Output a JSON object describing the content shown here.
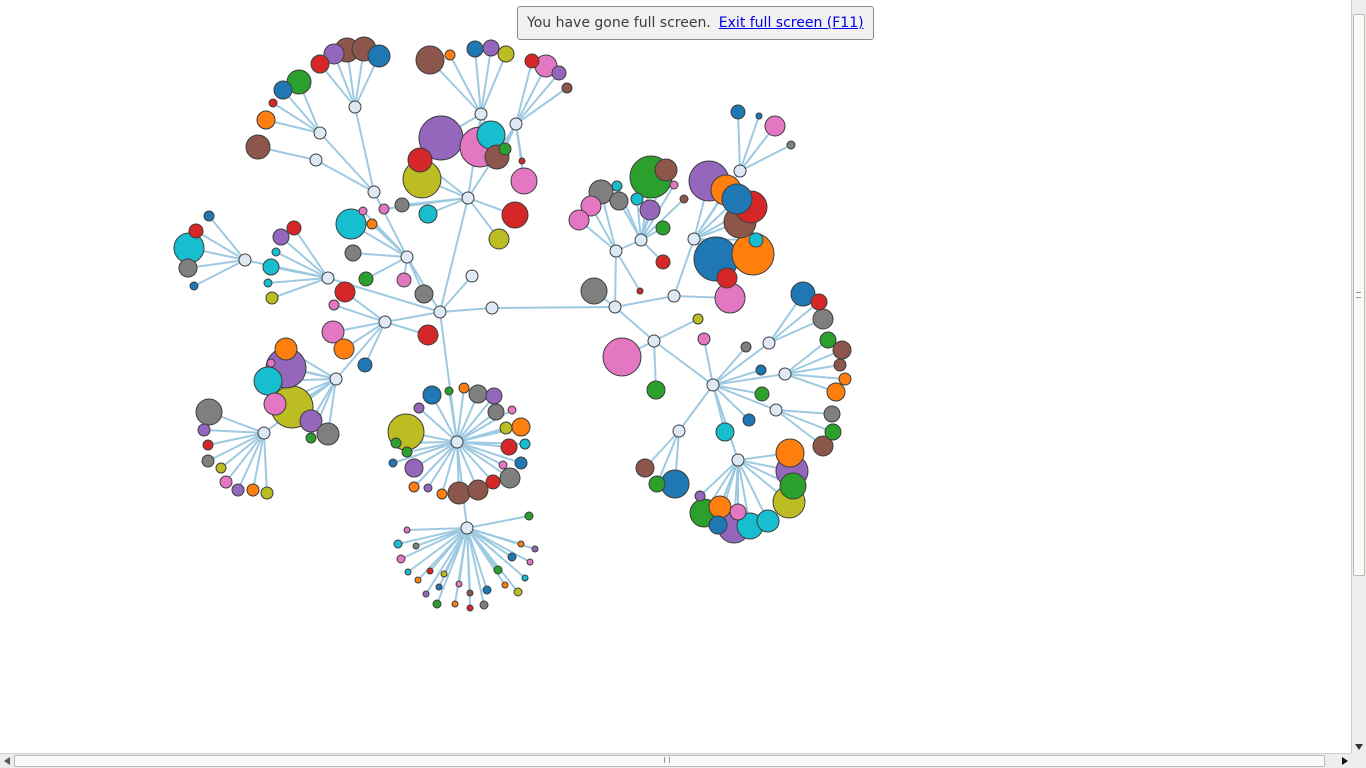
{
  "notice": {
    "message": "You have gone full screen.",
    "exit_link": "Exit full screen (F11)"
  },
  "icons": {
    "scroll_down": "arrow-down-icon",
    "scroll_left": "arrow-left-icon",
    "scroll_right": "arrow-right-icon"
  },
  "colors": {
    "link": "#9ecae1",
    "hub": "#dfe9f5",
    "stroke": "#3d3d3d",
    "palette": [
      "#1f77b4",
      "#ff7f0e",
      "#2ca02c",
      "#d62728",
      "#9467bd",
      "#8c564b",
      "#e377c2",
      "#7f7f7f",
      "#bcbd22",
      "#17becf"
    ]
  },
  "graph": {
    "type": "force-directed tree",
    "root": "root",
    "clusters": [
      {
        "id": "c-topleft",
        "parent": "h-upper",
        "leaves": [
          {
            "c": 5,
            "r": 12
          },
          {
            "c": 5,
            "r": 12
          },
          {
            "c": 0,
            "r": 11
          },
          {
            "c": 4,
            "r": 10
          },
          {
            "c": 3,
            "r": 9
          },
          {
            "c": 2,
            "r": 12
          },
          {
            "c": 0,
            "r": 9
          },
          {
            "c": 3,
            "r": 4
          },
          {
            "c": 1,
            "r": 9
          },
          {
            "c": 5,
            "r": 12
          }
        ]
      },
      {
        "id": "c-topmid",
        "parent": "h-center",
        "leaves": [
          {
            "c": 5,
            "r": 14
          },
          {
            "c": 1,
            "r": 5
          },
          {
            "c": 0,
            "r": 8
          },
          {
            "c": 4,
            "r": 8
          },
          {
            "c": 8,
            "r": 8
          },
          {
            "c": 3,
            "r": 7
          },
          {
            "c": 6,
            "r": 11
          },
          {
            "c": 4,
            "r": 7
          },
          {
            "c": 5,
            "r": 5
          },
          {
            "c": 4,
            "r": 22
          },
          {
            "c": 6,
            "r": 20
          },
          {
            "c": 8,
            "r": 19
          },
          {
            "c": 9,
            "r": 9
          },
          {
            "c": 3,
            "r": 13
          },
          {
            "c": 2,
            "r": 6
          },
          {
            "c": 6,
            "r": 13
          },
          {
            "c": 3,
            "r": 3
          },
          {
            "c": 9,
            "r": 14
          },
          {
            "c": 5,
            "r": 12
          },
          {
            "c": 7,
            "r": 7
          },
          {
            "c": 6,
            "r": 5
          },
          {
            "c": 8,
            "r": 10
          },
          {
            "c": 3,
            "r": 12
          }
        ]
      },
      {
        "id": "c-farleft",
        "parent": "h-left",
        "leaves": [
          {
            "c": 0,
            "r": 5
          },
          {
            "c": 3,
            "r": 7
          },
          {
            "c": 9,
            "r": 15
          },
          {
            "c": 7,
            "r": 9
          },
          {
            "c": 0,
            "r": 4
          }
        ]
      },
      {
        "id": "c-left",
        "parent": "h-midleft",
        "leaves": [
          {
            "c": 3,
            "r": 7
          },
          {
            "c": 4,
            "r": 8
          },
          {
            "c": 9,
            "r": 4
          },
          {
            "c": 9,
            "r": 8
          },
          {
            "c": 9,
            "r": 4
          },
          {
            "c": 8,
            "r": 6
          }
        ]
      },
      {
        "id": "c-inner",
        "parent": "root",
        "leaves": [
          {
            "c": 6,
            "r": 4
          },
          {
            "c": 1,
            "r": 5
          },
          {
            "c": 9,
            "r": 15
          },
          {
            "c": 7,
            "r": 8
          },
          {
            "c": 2,
            "r": 7
          },
          {
            "c": 6,
            "r": 7
          },
          {
            "c": 3,
            "r": 10
          },
          {
            "c": 7,
            "r": 9
          },
          {
            "c": 6,
            "r": 5
          },
          {
            "c": 6,
            "r": 11
          },
          {
            "c": 1,
            "r": 10
          },
          {
            "c": 0,
            "r": 7
          },
          {
            "c": 3,
            "r": 10
          }
        ]
      },
      {
        "id": "c-lowleft",
        "parent": "h-lowleft",
        "leaves": [
          {
            "c": 1,
            "r": 11
          },
          {
            "c": 4,
            "r": 20
          },
          {
            "c": 9,
            "r": 14
          },
          {
            "c": 8,
            "r": 21
          },
          {
            "c": 6,
            "r": 11
          },
          {
            "c": 4,
            "r": 11
          },
          {
            "c": 7,
            "r": 11
          },
          {
            "c": 2,
            "r": 5
          },
          {
            "c": 6,
            "r": 4
          }
        ]
      },
      {
        "id": "c-farlowleft",
        "parent": "h-farlowleft",
        "leaves": [
          {
            "c": 7,
            "r": 13
          },
          {
            "c": 4,
            "r": 6
          },
          {
            "c": 3,
            "r": 5
          },
          {
            "c": 7,
            "r": 6
          },
          {
            "c": 8,
            "r": 5
          },
          {
            "c": 6,
            "r": 6
          },
          {
            "c": 4,
            "r": 6
          },
          {
            "c": 1,
            "r": 6
          },
          {
            "c": 8,
            "r": 6
          }
        ]
      },
      {
        "id": "c-ring",
        "parent": "h-ring",
        "leaves": [
          {
            "c": 0,
            "r": 9
          },
          {
            "c": 2,
            "r": 4
          },
          {
            "c": 1,
            "r": 5
          },
          {
            "c": 7,
            "r": 9
          },
          {
            "c": 4,
            "r": 8
          },
          {
            "c": 7,
            "r": 8
          },
          {
            "c": 6,
            "r": 4
          },
          {
            "c": 1,
            "r": 9
          },
          {
            "c": 9,
            "r": 5
          },
          {
            "c": 3,
            "r": 8
          },
          {
            "c": 0,
            "r": 6
          },
          {
            "c": 7,
            "r": 10
          },
          {
            "c": 3,
            "r": 7
          },
          {
            "c": 5,
            "r": 10
          },
          {
            "c": 5,
            "r": 11
          },
          {
            "c": 1,
            "r": 5
          },
          {
            "c": 4,
            "r": 4
          },
          {
            "c": 1,
            "r": 5
          },
          {
            "c": 4,
            "r": 9
          },
          {
            "c": 0,
            "r": 4
          },
          {
            "c": 8,
            "r": 18
          },
          {
            "c": 2,
            "r": 5
          },
          {
            "c": 4,
            "r": 5
          },
          {
            "c": 2,
            "r": 5
          },
          {
            "c": 8,
            "r": 6
          },
          {
            "c": 6,
            "r": 4
          }
        ]
      },
      {
        "id": "c-fan",
        "parent": "h-fan",
        "leaves": [
          {
            "c": 6,
            "r": 3
          },
          {
            "c": 9,
            "r": 4
          },
          {
            "c": 7,
            "r": 3
          },
          {
            "c": 6,
            "r": 4
          },
          {
            "c": 9,
            "r": 3
          },
          {
            "c": 1,
            "r": 3
          },
          {
            "c": 3,
            "r": 3
          },
          {
            "c": 0,
            "r": 3
          },
          {
            "c": 8,
            "r": 3
          },
          {
            "c": 4,
            "r": 3
          },
          {
            "c": 2,
            "r": 4
          },
          {
            "c": 1,
            "r": 3
          },
          {
            "c": 6,
            "r": 3
          },
          {
            "c": 3,
            "r": 3
          },
          {
            "c": 5,
            "r": 3
          },
          {
            "c": 7,
            "r": 4
          },
          {
            "c": 0,
            "r": 4
          },
          {
            "c": 2,
            "r": 4
          },
          {
            "c": 1,
            "r": 3
          },
          {
            "c": 8,
            "r": 4
          },
          {
            "c": 9,
            "r": 3
          },
          {
            "c": 0,
            "r": 4
          },
          {
            "c": 6,
            "r": 3
          },
          {
            "c": 4,
            "r": 3
          },
          {
            "c": 1,
            "r": 3
          },
          {
            "c": 2,
            "r": 4
          }
        ]
      },
      {
        "id": "c-midright",
        "parent": "h-midright",
        "leaves": [
          {
            "c": 7,
            "r": 12
          },
          {
            "c": 6,
            "r": 10
          },
          {
            "c": 6,
            "r": 10
          },
          {
            "c": 7,
            "r": 9
          },
          {
            "c": 9,
            "r": 6
          },
          {
            "c": 9,
            "r": 5
          },
          {
            "c": 2,
            "r": 21
          },
          {
            "c": 5,
            "r": 11
          },
          {
            "c": 6,
            "r": 4
          },
          {
            "c": 5,
            "r": 4
          },
          {
            "c": 4,
            "r": 10
          },
          {
            "c": 2,
            "r": 7
          },
          {
            "c": 3,
            "r": 7
          },
          {
            "c": 3,
            "r": 3
          }
        ]
      },
      {
        "id": "c-toprightsmall",
        "parent": "h-topright",
        "leaves": [
          {
            "c": 0,
            "r": 7
          },
          {
            "c": 0,
            "r": 3
          },
          {
            "c": 6,
            "r": 10
          },
          {
            "c": 7,
            "r": 4
          }
        ]
      },
      {
        "id": "c-right",
        "parent": "h-right",
        "leaves": [
          {
            "c": 4,
            "r": 20
          },
          {
            "c": 1,
            "r": 15
          },
          {
            "c": 5,
            "r": 16
          },
          {
            "c": 3,
            "r": 16
          },
          {
            "c": 0,
            "r": 15
          },
          {
            "c": 9,
            "r": 7
          },
          {
            "c": 1,
            "r": 21
          },
          {
            "c": 0,
            "r": 22
          },
          {
            "c": 3,
            "r": 10
          },
          {
            "c": 6,
            "r": 15
          }
        ]
      },
      {
        "id": "c-farright",
        "parent": "h-farright",
        "leaves": [
          {
            "c": 0,
            "r": 12
          },
          {
            "c": 3,
            "r": 8
          },
          {
            "c": 7,
            "r": 10
          },
          {
            "c": 2,
            "r": 8
          },
          {
            "c": 5,
            "r": 9
          },
          {
            "c": 5,
            "r": 6
          },
          {
            "c": 1,
            "r": 6
          },
          {
            "c": 1,
            "r": 9
          },
          {
            "c": 7,
            "r": 8
          },
          {
            "c": 2,
            "r": 8
          },
          {
            "c": 5,
            "r": 10
          }
        ]
      },
      {
        "id": "c-lowright",
        "parent": "h-lowright",
        "leaves": [
          {
            "c": 5,
            "r": 9
          },
          {
            "c": 2,
            "r": 8
          },
          {
            "c": 0,
            "r": 14
          },
          {
            "c": 4,
            "r": 5
          },
          {
            "c": 2,
            "r": 14
          },
          {
            "c": 1,
            "r": 11
          },
          {
            "c": 0,
            "r": 9
          },
          {
            "c": 4,
            "r": 16
          },
          {
            "c": 9,
            "r": 13
          },
          {
            "c": 6,
            "r": 8
          },
          {
            "c": 9,
            "r": 11
          },
          {
            "c": 8,
            "r": 16
          },
          {
            "c": 2,
            "r": 13
          },
          {
            "c": 4,
            "r": 16
          },
          {
            "c": 1,
            "r": 14
          }
        ]
      },
      {
        "id": "c-scattered",
        "parent": "h-spine",
        "leaves": [
          {
            "c": 7,
            "r": 13
          },
          {
            "c": 6,
            "r": 19
          },
          {
            "c": 8,
            "r": 5
          },
          {
            "c": 6,
            "r": 6
          },
          {
            "c": 7,
            "r": 5
          },
          {
            "c": 0,
            "r": 5
          },
          {
            "c": 2,
            "r": 7
          },
          {
            "c": 0,
            "r": 6
          },
          {
            "c": 9,
            "r": 9
          },
          {
            "c": 2,
            "r": 9
          }
        ]
      }
    ]
  }
}
